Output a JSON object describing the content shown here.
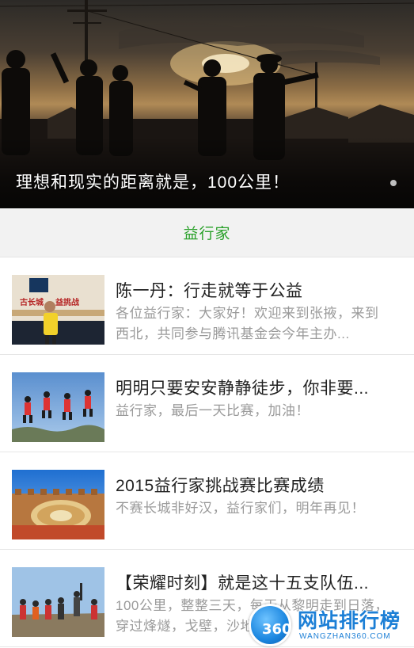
{
  "banner": {
    "caption": "理想和现实的距离就是，100公里！"
  },
  "section": {
    "title": "益行家"
  },
  "articles": [
    {
      "title": "陈一丹：行走就等于公益",
      "desc": "各位益行家：大家好！欢迎来到张掖，来到西北，共同参与腾讯基金会今年主办...",
      "thumb_icon": "speaker-on-stage-image"
    },
    {
      "title": "明明只要安安静静徒步，你非要...",
      "desc": "益行家，最后一天比赛，加油！",
      "thumb_icon": "jumping-group-image"
    },
    {
      "title": "2015益行家挑战赛比赛成绩",
      "desc": "不赛长城非好汉，益行家们，明年再见！",
      "thumb_icon": "great-wall-medal-image"
    },
    {
      "title": "【荣耀时刻】就是这十五支队伍...",
      "desc": "100公里，整整三天，每天从黎明走到日落，穿过烽燧，戈壁，沙地，",
      "thumb_icon": "team-celebration-image"
    }
  ],
  "watermark": {
    "badge": "360",
    "text": "网站排行榜",
    "sub": "WANGZHAN360.COM"
  },
  "colors": {
    "accent": "#2aa12a",
    "title_text": "#222222",
    "desc_text": "#9a9a9a",
    "header_bg": "#f2f2f2"
  }
}
